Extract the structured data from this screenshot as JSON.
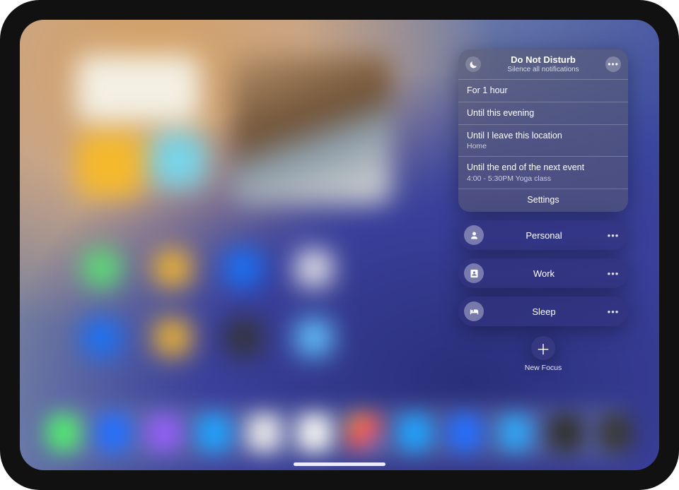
{
  "dnd": {
    "title": "Do Not Disturb",
    "subtitle": "Silence all notifications",
    "options": [
      {
        "label": "For 1 hour"
      },
      {
        "label": "Until this evening"
      },
      {
        "label": "Until I leave this location",
        "sub": "Home"
      },
      {
        "label": "Until the end of the next event",
        "sub": "4:00 - 5:30PM Yoga class"
      }
    ],
    "settings_label": "Settings"
  },
  "focus_modes": [
    {
      "name": "Personal",
      "icon": "person"
    },
    {
      "name": "Work",
      "icon": "badge"
    },
    {
      "name": "Sleep",
      "icon": "bed"
    }
  ],
  "new_focus_label": "New Focus"
}
